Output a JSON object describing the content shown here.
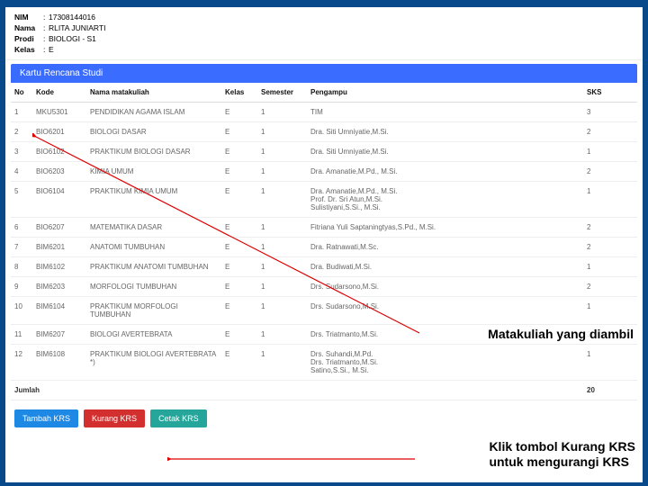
{
  "student": {
    "nim_label": "NIM",
    "nim": "17308144016",
    "nama_label": "Nama",
    "nama": "RLITA JUNIARTI",
    "prodi_label": "Prodi",
    "prodi": "BIOLOGI - S1",
    "kelas_label": "Kelas",
    "kelas": "E"
  },
  "card": {
    "title": "Kartu Rencana Studi"
  },
  "headers": {
    "no": "No",
    "kode": "Kode",
    "nama": "Nama matakuliah",
    "kelas": "Kelas",
    "semester": "Semester",
    "pengampu": "Pengampu",
    "sks": "SKS"
  },
  "rows": [
    {
      "no": "1",
      "kode": "MKU5301",
      "nama": "PENDIDIKAN AGAMA ISLAM",
      "kelas": "E",
      "sem": "1",
      "pengampu": "TIM",
      "sks": "3"
    },
    {
      "no": "2",
      "kode": "BIO6201",
      "nama": "BIOLOGI DASAR",
      "kelas": "E",
      "sem": "1",
      "pengampu": "Dra. Siti Umniyatie,M.Si.",
      "sks": "2"
    },
    {
      "no": "3",
      "kode": "BIO6102",
      "nama": "PRAKTIKUM BIOLOGI DASAR",
      "kelas": "E",
      "sem": "1",
      "pengampu": "Dra. Siti Umniyatie,M.Si.",
      "sks": "1"
    },
    {
      "no": "4",
      "kode": "BIO6203",
      "nama": "KIMIA UMUM",
      "kelas": "E",
      "sem": "1",
      "pengampu": "Dra. Amanatie,M.Pd., M.Si.",
      "sks": "2"
    },
    {
      "no": "5",
      "kode": "BIO6104",
      "nama": "PRAKTIKUM KIMIA UMUM",
      "kelas": "E",
      "sem": "1",
      "pengampu": "Dra. Amanatie,M.Pd., M.Si.\nProf. Dr. Sri Atun,M.Si.\nSulistiyani,S.Si., M.Si.",
      "sks": "1"
    },
    {
      "no": "6",
      "kode": "BIO6207",
      "nama": "MATEMATIKA DASAR",
      "kelas": "E",
      "sem": "1",
      "pengampu": "Fitriana Yuli Saptaningtyas,S.Pd., M.Si.",
      "sks": "2"
    },
    {
      "no": "7",
      "kode": "BIM6201",
      "nama": "ANATOMI TUMBUHAN",
      "kelas": "E",
      "sem": "1",
      "pengampu": "Dra. Ratnawati,M.Sc.",
      "sks": "2"
    },
    {
      "no": "8",
      "kode": "BIM6102",
      "nama": "PRAKTIKUM ANATOMI TUMBUHAN",
      "kelas": "E",
      "sem": "1",
      "pengampu": "Dra. Budiwati,M.Si.",
      "sks": "1"
    },
    {
      "no": "9",
      "kode": "BIM6203",
      "nama": "MORFOLOGI TUMBUHAN",
      "kelas": "E",
      "sem": "1",
      "pengampu": "Drs. Sudarsono,M.Si.",
      "sks": "2"
    },
    {
      "no": "10",
      "kode": "BIM6104",
      "nama": "PRAKTIKUM MORFOLOGI TUMBUHAN",
      "kelas": "E",
      "sem": "1",
      "pengampu": "Drs. Sudarsono,M.Si.",
      "sks": "1"
    },
    {
      "no": "11",
      "kode": "BIM6207",
      "nama": "BIOLOGI AVERTEBRATA",
      "kelas": "E",
      "sem": "1",
      "pengampu": "Drs. Triatmanto,M.Si.",
      "sks": "2"
    },
    {
      "no": "12",
      "kode": "BIM6108",
      "nama": "PRAKTIKUM BIOLOGI AVERTEBRATA *)",
      "kelas": "E",
      "sem": "1",
      "pengampu": "Drs. Suhandi,M.Pd.\nDrs. Triatmanto,M.Si.\nSatino,S.Si., M.Si.",
      "sks": "1"
    }
  ],
  "jumlah": {
    "label": "Jumlah",
    "total": "20"
  },
  "buttons": {
    "tambah": "Tambah KRS",
    "kurang": "Kurang KRS",
    "cetak": "Cetak KRS"
  },
  "annotations": {
    "a1": "Matakuliah yang diambil",
    "a2_l1": "Klik tombol Kurang KRS",
    "a2_l2": "untuk mengurangi KRS"
  }
}
